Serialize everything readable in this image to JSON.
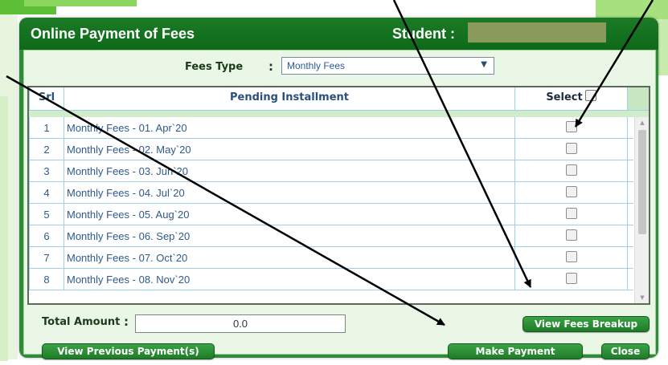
{
  "dialog": {
    "title": "Online Payment of Fees",
    "student_label": "Student :",
    "student_value": ""
  },
  "filters": {
    "fees_type_label": "Fees Type",
    "fees_type_colon": ":",
    "fees_type_selected": "Monthly Fees"
  },
  "table": {
    "headers": {
      "srl": "Srl",
      "installment": "Pending Installment",
      "select": "Select"
    },
    "rows": [
      {
        "srl": "1",
        "installment": "Monthly Fees - 01. Apr`20",
        "checked": false
      },
      {
        "srl": "2",
        "installment": "Monthly Fees - 02. May`20",
        "checked": false
      },
      {
        "srl": "3",
        "installment": "Monthly Fees - 03. Jun`20",
        "checked": false
      },
      {
        "srl": "4",
        "installment": "Monthly Fees - 04. Jul`20",
        "checked": false
      },
      {
        "srl": "5",
        "installment": "Monthly Fees - 05. Aug`20",
        "checked": false
      },
      {
        "srl": "6",
        "installment": "Monthly Fees - 06. Sep`20",
        "checked": false
      },
      {
        "srl": "7",
        "installment": "Monthly Fees - 07. Oct`20",
        "checked": false
      },
      {
        "srl": "8",
        "installment": "Monthly Fees - 08. Nov`20",
        "checked": false
      }
    ]
  },
  "totals": {
    "label": "Total Amount",
    "colon": ":",
    "value": "0.0"
  },
  "buttons": {
    "view_fees_breakup": "View Fees Breakup",
    "view_previous_payments": "View Previous Payment(s)",
    "make_payment": "Make Payment",
    "close": "Close"
  },
  "icons": {
    "dropdown": "chevron-down-icon",
    "scroll_up": "arrow-up-icon",
    "scroll_down": "arrow-down-icon",
    "annotation": "pointer-arrow-icon"
  },
  "colors": {
    "title_bar": "#0c6a18",
    "content_bg": "#eaf7e6",
    "button": "#1f7c29",
    "link_text": "#2d5a8c",
    "student_redaction": "#8a9a5b"
  }
}
